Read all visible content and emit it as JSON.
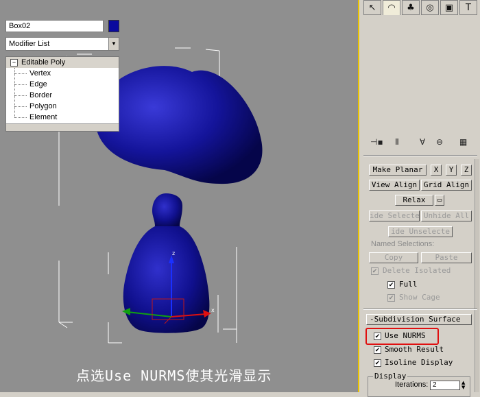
{
  "viewport": {
    "caption": "点选Use NURMS使其光滑显示",
    "axis_z": "z",
    "axis_x": "x"
  },
  "colors": {
    "object_color": "#0a0a9e",
    "viewport_bg": "#8f8f8f",
    "highlight": "#e01010"
  },
  "command_panel": {
    "tabs": [
      {
        "icon": "create-icon",
        "glyph": "↖"
      },
      {
        "icon": "modify-icon",
        "glyph": "◠"
      },
      {
        "icon": "hierarchy-icon",
        "glyph": "♣"
      },
      {
        "icon": "motion-icon",
        "glyph": "◎"
      },
      {
        "icon": "display-icon",
        "glyph": "▣"
      },
      {
        "icon": "utilities-icon",
        "glyph": "T"
      }
    ],
    "object_name": "Box02",
    "modifier_list": "Modifier List",
    "stack": {
      "top": "Editable Poly",
      "subobjects": [
        "Vertex",
        "Edge",
        "Border",
        "Polygon",
        "Element"
      ]
    }
  },
  "edit_geometry": {
    "make_planar": "Make Planar",
    "x": "X",
    "y": "Y",
    "z": "Z",
    "view_align": "View Align",
    "grid_align": "Grid Align",
    "relax": "Relax",
    "hide_selected": "ide Selecte",
    "unhide_all": "Unhide All",
    "hide_unselected": "ide Unselecte",
    "named_selections": "Named Selections:",
    "copy": "Copy",
    "paste": "Paste",
    "delete_isolated": "Delete Isolated",
    "full": "Full",
    "show_cage": "Show Cage"
  },
  "subdivision": {
    "title": "Subdivision Surface",
    "use_nurms": "Use NURMS",
    "smooth_result": "Smooth Result",
    "isoline_display": "Isoline Display",
    "display": "Display",
    "iterations_label": "Iterations:",
    "iterations_value": "2"
  }
}
